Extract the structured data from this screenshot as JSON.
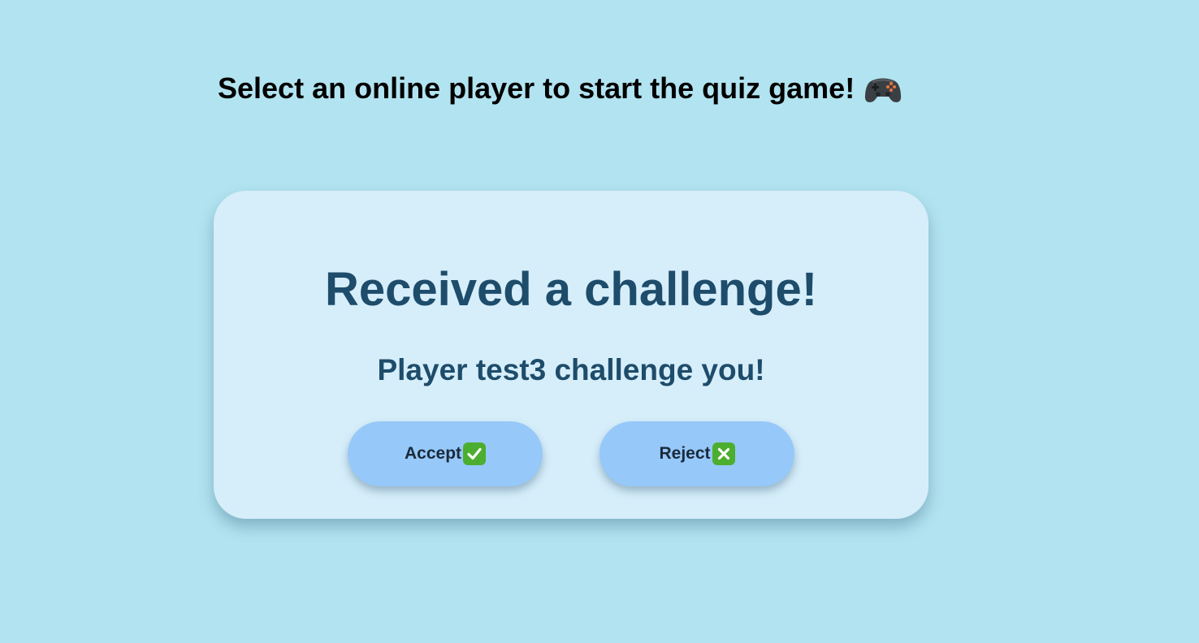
{
  "page": {
    "title": "Select an online player to start the quiz game!",
    "title_icon": "gamepad-icon"
  },
  "challenge": {
    "heading": "Received a challenge!",
    "message": "Player test3 challenge you!",
    "accept_label": "Accept",
    "accept_icon": "check-mark-icon",
    "reject_label": "Reject",
    "reject_icon": "cross-mark-icon"
  },
  "colors": {
    "background": "#b2e3f0",
    "card": "#d6eefa",
    "heading_text": "#1e4c6b",
    "button": "#96c8fa",
    "icon_green": "#4cae2e"
  }
}
